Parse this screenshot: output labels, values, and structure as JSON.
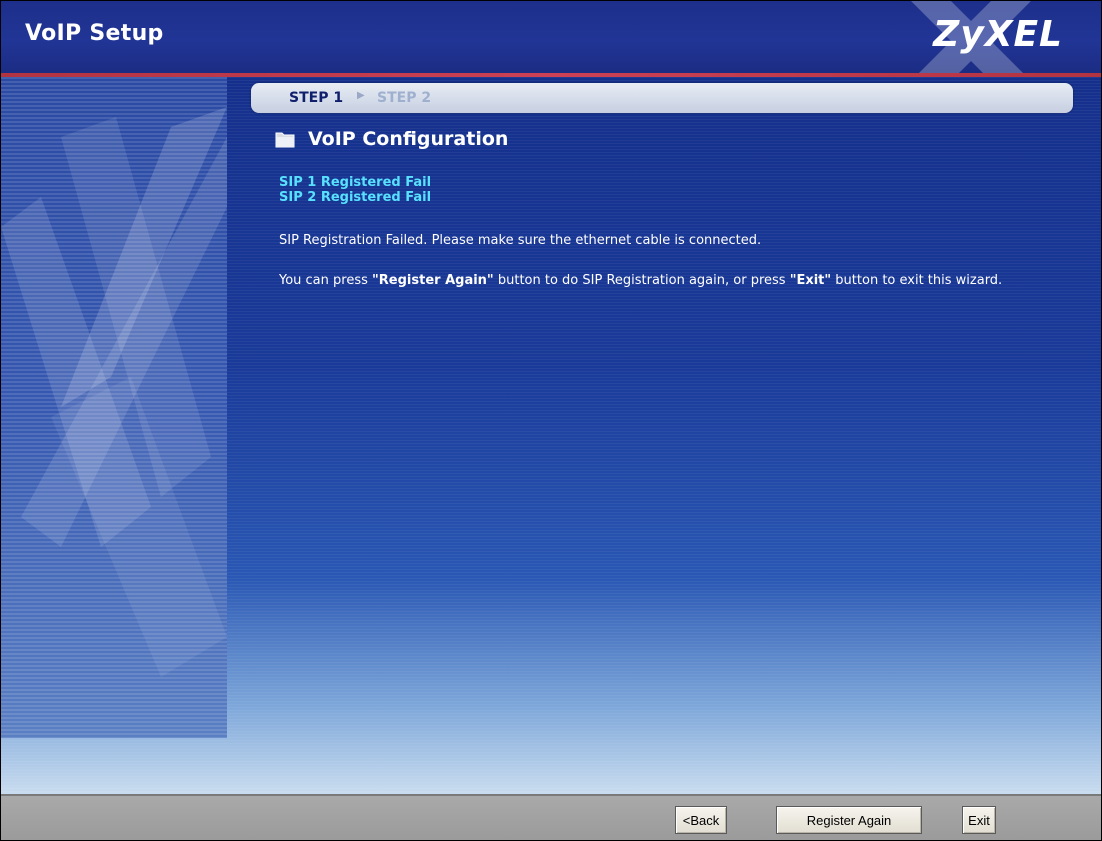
{
  "header": {
    "title": "VoIP Setup",
    "logo": "ZyXEL"
  },
  "steps": {
    "active": "STEP 1",
    "separator": "▶",
    "inactive": "STEP 2"
  },
  "section": {
    "icon": "folder-icon",
    "title": "VoIP Configuration"
  },
  "status": {
    "sip1": "SIP 1 Registered Fail",
    "sip2": "SIP 2 Registered Fail"
  },
  "message": {
    "line1": "SIP Registration Failed. Please make sure the ethernet cable is connected.",
    "line2_prefix": "You can press ",
    "line2_register": "\"Register Again\"",
    "line2_mid": " button to do SIP Registration again, or press ",
    "line2_exit": "\"Exit\"",
    "line2_suffix": " button to exit this wizard."
  },
  "footer": {
    "back_label": "<Back",
    "register_label": "Register Again",
    "exit_label": "Exit"
  },
  "colors": {
    "header": "#1d2f8a",
    "accent_line": "#cc4155",
    "status_text": "#58e1ff",
    "footer": "#a9a9a9"
  }
}
